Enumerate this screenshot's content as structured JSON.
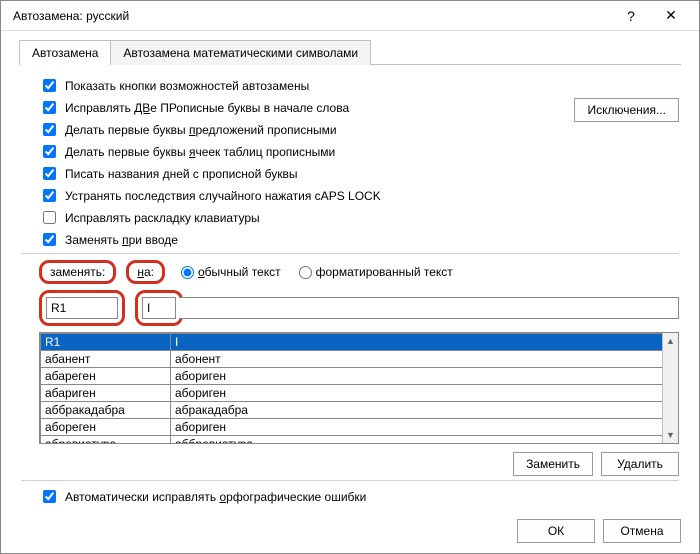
{
  "title": "Автозамена: русский",
  "tabs": {
    "t0": "Автозамена",
    "t1": "Автозамена математическими символами"
  },
  "checks": {
    "c0": "Показать кнопки возможностей автозамены",
    "c1_a": "Исправлять ",
    "c1_b": "ДВ",
    "c1_c": "е ПРописные буквы в начале слова",
    "c2_a": "Делать первые буквы ",
    "c2_b": "п",
    "c2_c": "редложений прописными",
    "c3_a": "Делать первые буквы ",
    "c3_b": "я",
    "c3_c": "чеек таблиц прописными",
    "c4": "Писать названия дней с прописной буквы",
    "c5": "Устранять последствия случайного нажатия cAPS LOCK",
    "c6": "Исправлять раскладку клавиатуры",
    "c7_a": "Заменять ",
    "c7_b": "п",
    "c7_c": "ри вводе"
  },
  "btn_exceptions": "Исключения...",
  "labels": {
    "replace_a": "заменять:",
    "with_a": "н",
    "with_b": "а:",
    "plain_a": "о",
    "plain_b": "бычный текст",
    "formatted": "форматированный текст"
  },
  "inputs": {
    "replace": "R1",
    "with": "I"
  },
  "table": {
    "r0c0": "R1",
    "r0c1": "I",
    "r1c0": "абанент",
    "r1c1": "абонент",
    "r2c0": "абареген",
    "r2c1": "абориген",
    "r3c0": "абариген",
    "r3c1": "абориген",
    "r4c0": "аббракадабра",
    "r4c1": "абракадабра",
    "r5c0": "абореген",
    "r5c1": "абориген",
    "r6c0": "абревиатура",
    "r6c1": "аббревиатура"
  },
  "btn_replace": "Заменить",
  "btn_delete": "Удалить",
  "check_spell_a": "Автоматически исправлять ",
  "check_spell_b": "о",
  "check_spell_c": "рфографические ошибки",
  "btn_ok": "ОК",
  "btn_cancel": "Отмена"
}
